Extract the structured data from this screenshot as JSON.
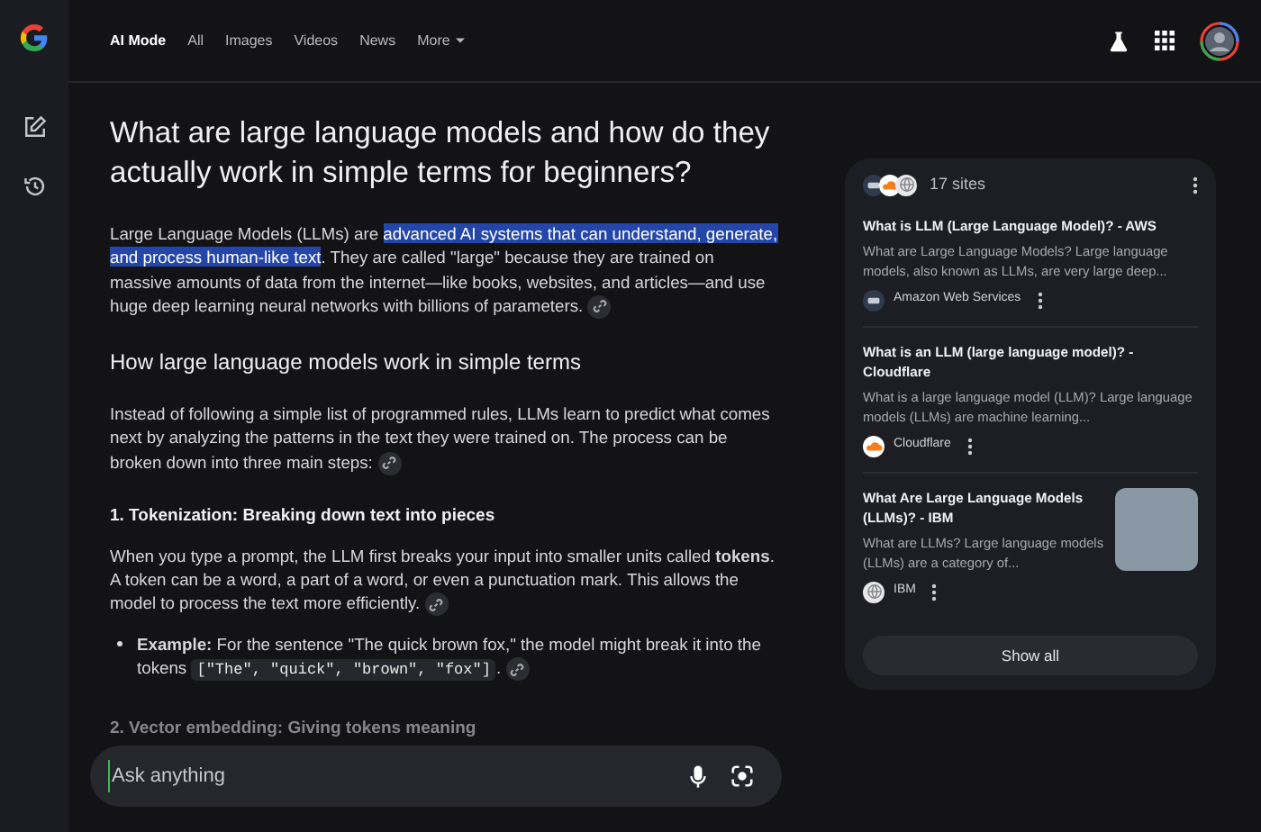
{
  "nav": {
    "tabs": [
      {
        "label": "AI Mode",
        "selected": true,
        "kind": "link"
      },
      {
        "label": "All",
        "selected": false,
        "kind": "link"
      },
      {
        "label": "Images",
        "selected": false,
        "kind": "link"
      },
      {
        "label": "Videos",
        "selected": false,
        "kind": "link"
      },
      {
        "label": "News",
        "selected": false,
        "kind": "link"
      },
      {
        "label": "More",
        "selected": false,
        "kind": "menu"
      }
    ]
  },
  "answer": {
    "question": "What are large language models and how do they actually work in simple terms for beginners?",
    "blocks": [
      {
        "kind": "highlight_para",
        "before": "Large Language Models (LLMs) are ",
        "highlight": "advanced AI systems that can understand, generate, and process human-like text",
        "after": ". They are called \"large\" because they are trained on massive amounts of data from the internet—like books, websites, and articles—and use huge deep learning neural networks with billions of parameters.",
        "link": true
      },
      {
        "kind": "h2",
        "text": "How large language models work in simple terms"
      },
      {
        "kind": "para",
        "text": "Instead of following a simple list of programmed rules, LLMs learn to predict what comes next by analyzing the patterns in the text they were trained on. The process can be broken down into three main steps:",
        "link": true
      },
      {
        "kind": "h3",
        "text": "1. Tokenization: Breaking down text into pieces",
        "faded": false
      },
      {
        "kind": "para",
        "text": "When you type a prompt, the LLM first breaks your input into smaller units called **tokens**. A token can be a word, a part of a word, or even a punctuation mark. This allows the model to process the text more efficiently.",
        "link": true
      },
      {
        "kind": "bullet",
        "text": "**Example:** For the sentence \"The quick brown fox,\" the model might break it into the tokens ",
        "code": "[\"The\", \"quick\", \"brown\", \"fox\"]",
        "after": ".",
        "link": true
      },
      {
        "kind": "h3",
        "text": "2. Vector embedding: Giving tokens meaning",
        "faded": true
      }
    ]
  },
  "input": {
    "placeholder": "Ask anything"
  },
  "sources": {
    "count": "17 sites",
    "items": [
      {
        "title": "What is LLM (Large Language Model)? - AWS",
        "snippet": "What are Large Language Models? Large language models, also known as LLMs, are very large deep...",
        "source": "Amazon Web Services",
        "kind": "box",
        "thumbnail": false
      },
      {
        "title": "What is an LLM (large language model)? - Cloudflare",
        "snippet": "What is a large language model (LLM)? Large language models (LLMs) are machine learning...",
        "source": "Cloudflare",
        "kind": "cloud",
        "thumbnail": false
      },
      {
        "title": "What Are Large Language Models (LLMs)? - IBM",
        "snippet": "What are LLMs? Large language models (LLMs) are a category of...",
        "source": "IBM",
        "kind": "globe",
        "thumbnail": true
      }
    ],
    "button": "Show all"
  }
}
